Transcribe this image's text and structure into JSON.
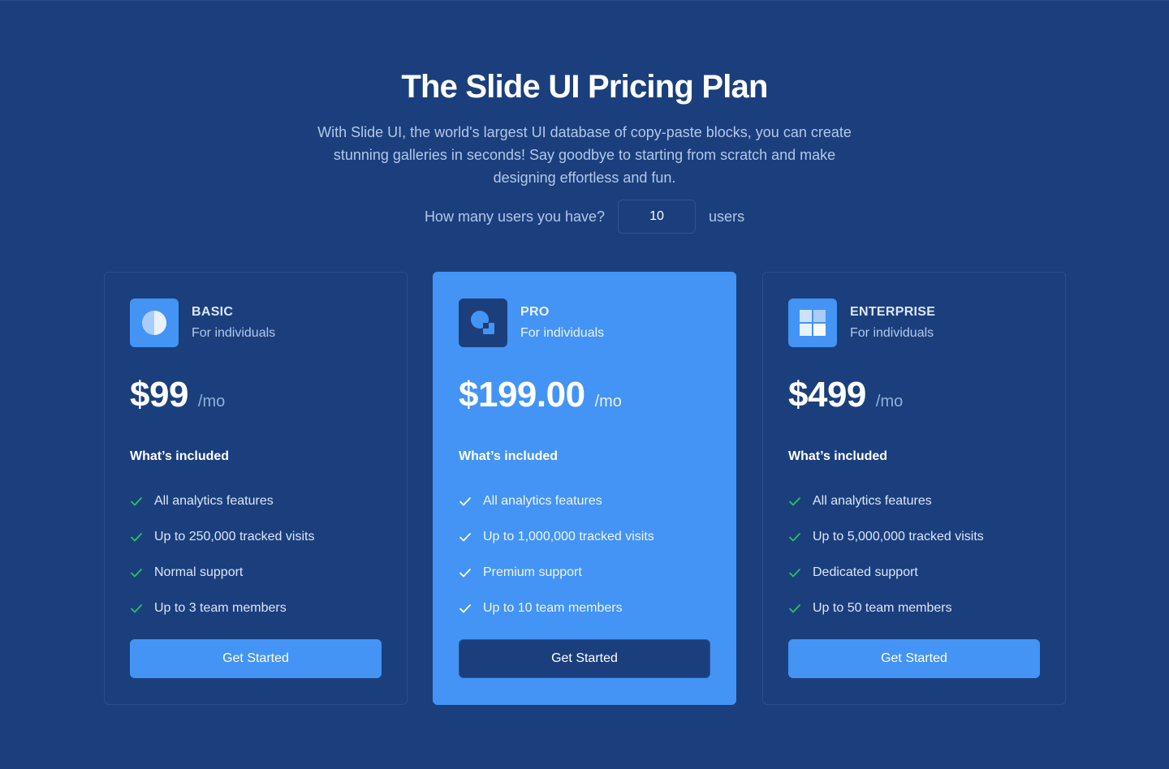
{
  "header": {
    "title": "The Slide UI Pricing Plan",
    "subtitle": "With Slide UI, the world's largest UI database of copy-paste blocks, you can create stunning galleries in seconds! Say goodbye to starting from scratch and make designing effortless and fun."
  },
  "users": {
    "question": "How many users you have?",
    "value": "10",
    "suffix": "users"
  },
  "colors": {
    "background": "#1b3f7d",
    "accent": "#4394f4",
    "check": "#22c55e"
  },
  "plans": [
    {
      "icon": "half-circle-icon",
      "name": "BASIC",
      "desc": "For individuals",
      "price": "$99",
      "period": "/mo",
      "included_label": "What’s included",
      "features": [
        "All analytics features",
        "Up to 250,000 tracked visits",
        "Normal support",
        "Up to 3 team members"
      ],
      "cta": "Get Started"
    },
    {
      "icon": "shapes-icon",
      "name": "PRO",
      "desc": "For individuals",
      "price": "$199.00",
      "period": "/mo",
      "included_label": "What’s included",
      "features": [
        "All analytics features",
        "Up to 1,000,000 tracked visits",
        "Premium support",
        "Up to 10 team members"
      ],
      "cta": "Get Started"
    },
    {
      "icon": "grid-icon",
      "name": "ENTERPRISE",
      "desc": "For individuals",
      "price": "$499",
      "period": "/mo",
      "included_label": "What’s included",
      "features": [
        "All analytics features",
        "Up to 5,000,000 tracked visits",
        "Dedicated support",
        "Up to 50 team members"
      ],
      "cta": "Get Started"
    }
  ]
}
